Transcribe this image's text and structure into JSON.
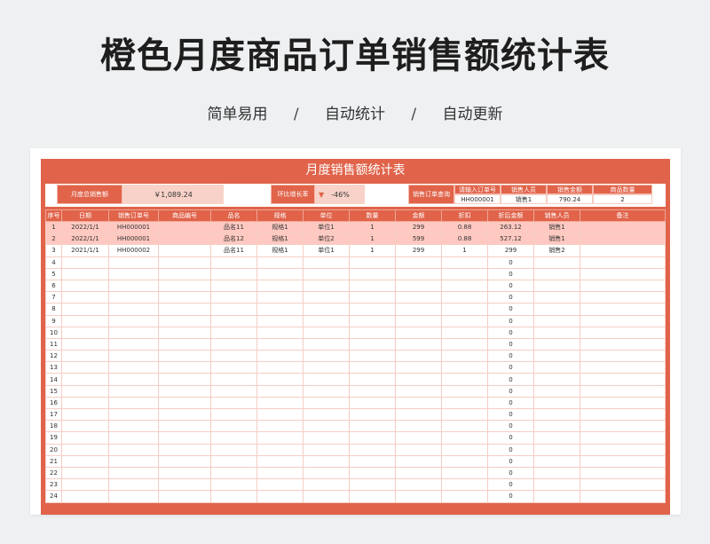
{
  "page": {
    "title": "橙色月度商品订单销售额统计表",
    "subtitle": [
      "简单易用",
      "自动统计",
      "自动更新"
    ],
    "separator": "/"
  },
  "sheet": {
    "title": "月度销售额统计表",
    "summary": {
      "total_label": "月度总销售额",
      "total_value": "￥1,089.24",
      "growth_label": "环比增长率",
      "growth_value": "-46%",
      "lookup_label": "销售订单查询",
      "lookup_headers": [
        "请输入订单号",
        "销售人员",
        "销售金额",
        "商品数量"
      ],
      "lookup_values": [
        "HH000001",
        "销售1",
        "790.24",
        "2"
      ]
    },
    "table": {
      "headers": [
        "序号",
        "日期",
        "销售订单号",
        "商品编号",
        "品名",
        "规格",
        "单位",
        "数量",
        "金额",
        "折扣",
        "折后金额",
        "销售人员",
        "备注"
      ],
      "rows": [
        [
          "1",
          "2022/1/1",
          "HH000001",
          "",
          "品名11",
          "规格1",
          "单位1",
          "1",
          "299",
          "0.88",
          "263.12",
          "销售1",
          ""
        ],
        [
          "2",
          "2022/1/1",
          "HH000001",
          "",
          "品名12",
          "规格1",
          "单位2",
          "1",
          "599",
          "0.88",
          "527.12",
          "销售1",
          ""
        ],
        [
          "3",
          "2021/1/1",
          "HH000002",
          "",
          "品名11",
          "规格1",
          "单位1",
          "1",
          "299",
          "1",
          "299",
          "销售2",
          ""
        ],
        [
          "4",
          "",
          "",
          "",
          "",
          "",
          "",
          "",
          "",
          "",
          "0",
          "",
          ""
        ],
        [
          "5",
          "",
          "",
          "",
          "",
          "",
          "",
          "",
          "",
          "",
          "0",
          "",
          ""
        ],
        [
          "6",
          "",
          "",
          "",
          "",
          "",
          "",
          "",
          "",
          "",
          "0",
          "",
          ""
        ],
        [
          "7",
          "",
          "",
          "",
          "",
          "",
          "",
          "",
          "",
          "",
          "0",
          "",
          ""
        ],
        [
          "8",
          "",
          "",
          "",
          "",
          "",
          "",
          "",
          "",
          "",
          "0",
          "",
          ""
        ],
        [
          "9",
          "",
          "",
          "",
          "",
          "",
          "",
          "",
          "",
          "",
          "0",
          "",
          ""
        ],
        [
          "10",
          "",
          "",
          "",
          "",
          "",
          "",
          "",
          "",
          "",
          "0",
          "",
          ""
        ],
        [
          "11",
          "",
          "",
          "",
          "",
          "",
          "",
          "",
          "",
          "",
          "0",
          "",
          ""
        ],
        [
          "12",
          "",
          "",
          "",
          "",
          "",
          "",
          "",
          "",
          "",
          "0",
          "",
          ""
        ],
        [
          "13",
          "",
          "",
          "",
          "",
          "",
          "",
          "",
          "",
          "",
          "0",
          "",
          ""
        ],
        [
          "14",
          "",
          "",
          "",
          "",
          "",
          "",
          "",
          "",
          "",
          "0",
          "",
          ""
        ],
        [
          "15",
          "",
          "",
          "",
          "",
          "",
          "",
          "",
          "",
          "",
          "0",
          "",
          ""
        ],
        [
          "16",
          "",
          "",
          "",
          "",
          "",
          "",
          "",
          "",
          "",
          "0",
          "",
          ""
        ],
        [
          "17",
          "",
          "",
          "",
          "",
          "",
          "",
          "",
          "",
          "",
          "0",
          "",
          ""
        ],
        [
          "18",
          "",
          "",
          "",
          "",
          "",
          "",
          "",
          "",
          "",
          "0",
          "",
          ""
        ],
        [
          "19",
          "",
          "",
          "",
          "",
          "",
          "",
          "",
          "",
          "",
          "0",
          "",
          ""
        ],
        [
          "20",
          "",
          "",
          "",
          "",
          "",
          "",
          "",
          "",
          "",
          "0",
          "",
          ""
        ],
        [
          "21",
          "",
          "",
          "",
          "",
          "",
          "",
          "",
          "",
          "",
          "0",
          "",
          ""
        ],
        [
          "22",
          "",
          "",
          "",
          "",
          "",
          "",
          "",
          "",
          "",
          "0",
          "",
          ""
        ],
        [
          "23",
          "",
          "",
          "",
          "",
          "",
          "",
          "",
          "",
          "",
          "0",
          "",
          ""
        ],
        [
          "24",
          "",
          "",
          "",
          "",
          "",
          "",
          "",
          "",
          "",
          "0",
          "",
          ""
        ]
      ],
      "highlight_rows": [
        0,
        1
      ]
    }
  },
  "colors": {
    "accent": "#e0634a",
    "highlight": "#ffc9c1",
    "pink_value": "#f8d2c8"
  },
  "icons": {
    "growth": "down-arrow-icon"
  }
}
